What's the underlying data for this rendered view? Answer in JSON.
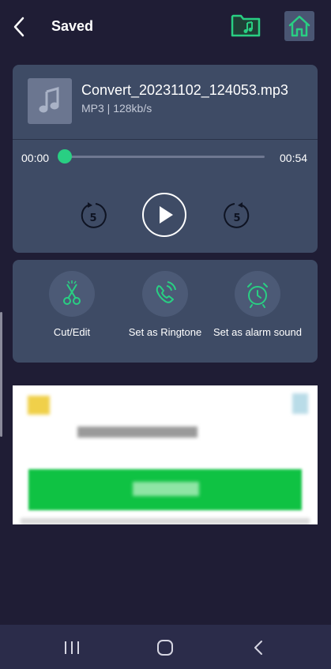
{
  "header": {
    "title": "Saved",
    "back_icon": "chevron-left-icon",
    "folder_icon": "music-folder-icon",
    "home_icon": "home-icon"
  },
  "player": {
    "file_name": "Convert_20231102_124053.mp3",
    "meta": "MP3 | 128kb/s",
    "current_time": "00:00",
    "duration": "00:54",
    "progress": 0,
    "rewind_label": "5",
    "forward_label": "5"
  },
  "actions": [
    {
      "label": "Cut/Edit",
      "icon": "scissors-icon"
    },
    {
      "label": "Set as Ringtone",
      "icon": "phone-ringing-icon"
    },
    {
      "label": "Set as alarm sound",
      "icon": "alarm-clock-icon"
    }
  ],
  "colors": {
    "background": "#1f1d35",
    "card": "#3e4b65",
    "accent": "#29cf83",
    "nav_bar": "#2b2c4a"
  }
}
